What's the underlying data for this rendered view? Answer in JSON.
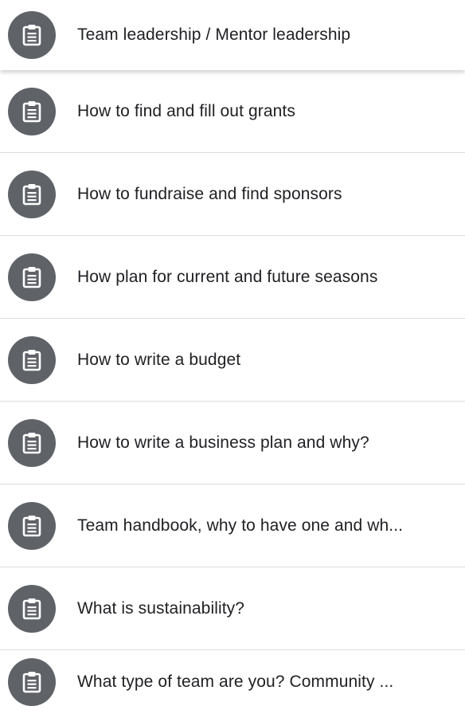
{
  "icon": "assignment-icon",
  "colors": {
    "icon_background": "#5f6368",
    "icon_foreground": "#ffffff",
    "text": "#202124",
    "divider": "#dcdcdc"
  },
  "items": [
    {
      "label": "Team leadership / Mentor leadership"
    },
    {
      "label": "How to find and fill out grants"
    },
    {
      "label": "How to fundraise and find sponsors"
    },
    {
      "label": "How plan for current and future seasons"
    },
    {
      "label": "How to write a budget"
    },
    {
      "label": "How to write a business plan and why?"
    },
    {
      "label": "Team handbook, why to have one and wh..."
    },
    {
      "label": "What is sustainability?"
    },
    {
      "label": "What type of team are you? Community ..."
    }
  ]
}
